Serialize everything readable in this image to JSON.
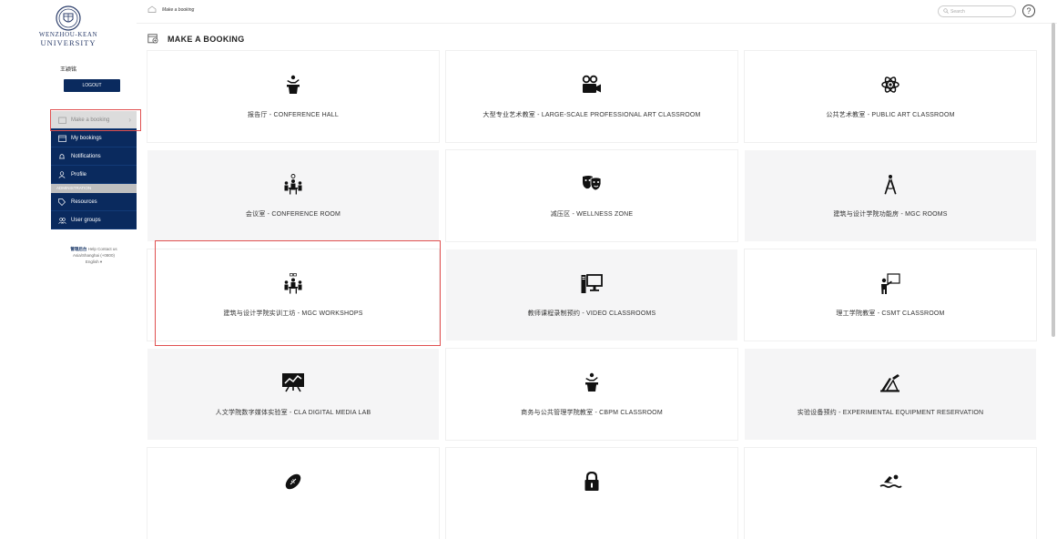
{
  "university": {
    "line1": "WENZHOU-KEAN",
    "line2": "UNIVERSITY"
  },
  "user": {
    "name": "王颖铭"
  },
  "logout_label": "LOGOUT",
  "nav": {
    "make_booking": "Make a booking",
    "my_bookings": "My bookings",
    "notifications": "Notifications",
    "profile": "Profile",
    "admin_section": "ADMINISTRATION",
    "resources": "Resources",
    "user_groups": "User groups"
  },
  "footer": {
    "link1": "管理后台",
    "link2": "Help",
    "link3": "Contact us",
    "timezone": "Asia/Shanghai (+0800)",
    "language": "English"
  },
  "breadcrumb": "Make a booking",
  "search_placeholder": "Search",
  "help_symbol": "?",
  "page_title": "MAKE A BOOKING",
  "cards": [
    {
      "label": "报告厅 - CONFERENCE HALL",
      "icon": "lectern-icon"
    },
    {
      "label": "大型专业艺术教室 - LARGE-SCALE PROFESSIONAL ART CLASSROOM",
      "icon": "video-camera-icon"
    },
    {
      "label": "公共艺术教室 - PUBLIC ART CLASSROOM",
      "icon": "atom-icon"
    },
    {
      "label": "会议室 - CONFERENCE ROOM",
      "icon": "meeting-icon"
    },
    {
      "label": "减压区 - WELLNESS ZONE",
      "icon": "theater-masks-icon"
    },
    {
      "label": "建筑与设计学院功能房 - MGC ROOMS",
      "icon": "compass-drafting-icon"
    },
    {
      "label": "建筑与设计学院实训工坊 - MGC WORKSHOPS",
      "icon": "workshop-meeting-icon"
    },
    {
      "label": "教师课程录制预约 - VIDEO CLASSROOMS",
      "icon": "desktop-computer-icon"
    },
    {
      "label": "理工学院教室 - CSMT CLASSROOM",
      "icon": "teacher-board-icon"
    },
    {
      "label": "人文学院数字媒体实验室 - CLA DIGITAL MEDIA LAB",
      "icon": "presentation-chart-icon"
    },
    {
      "label": "商务与公共管理学院教室 - CBPM CLASSROOM",
      "icon": "lectern-icon"
    },
    {
      "label": "实验设备预约 - EXPERIMENTAL EQUIPMENT RESERVATION",
      "icon": "drafting-tools-icon"
    },
    {
      "label": "",
      "icon": "football-icon"
    },
    {
      "label": "",
      "icon": "lock-icon"
    },
    {
      "label": "",
      "icon": "swimmer-icon"
    }
  ],
  "colors": {
    "nav_bg": "#0a2a5e",
    "highlight": "#e05050",
    "card_gray": "#f5f5f6"
  }
}
